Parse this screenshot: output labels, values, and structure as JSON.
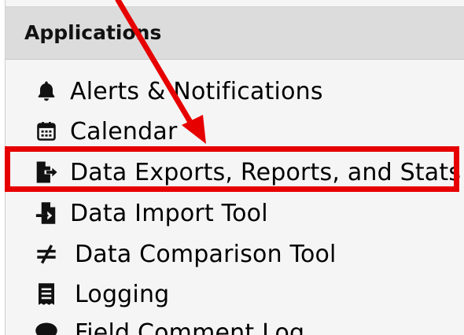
{
  "panel": {
    "title": "Applications"
  },
  "menu": [
    {
      "label": "Alerts & Notifications",
      "icon": "bell-icon"
    },
    {
      "label": "Calendar",
      "icon": "calendar-icon"
    },
    {
      "label": "Data Exports, Reports, and Stats",
      "icon": "file-export-icon"
    },
    {
      "label": "Data Import Tool",
      "icon": "file-import-icon"
    },
    {
      "label": "Data Comparison Tool",
      "icon": "not-equal-icon"
    },
    {
      "label": "Logging",
      "icon": "receipt-icon"
    },
    {
      "label": "Field Comment Log",
      "icon": "comment-icon"
    }
  ],
  "annotation": {
    "highlight_color": "#e60000",
    "highlighted_item": "Data Exports, Reports, and Stats"
  }
}
